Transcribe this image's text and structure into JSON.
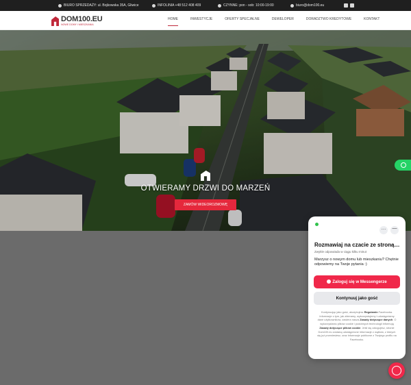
{
  "topbar": {
    "office": "BIURO SPRZEDAŻY: ul. Bojkowska 35A, Gliwice",
    "phone": "INFOLINIA +48 512 408 409",
    "hours": "CZYNNE: pon - sob: 10:00-19:00",
    "email": "biuro@dom100.eu",
    "social_icons": [
      "facebook-icon",
      "instagram-icon"
    ]
  },
  "header": {
    "logo_name": "DOM100.EU",
    "logo_tagline": "NOWE DOMY I MIESZKANIA",
    "nav": [
      {
        "label": "HOME",
        "active": true
      },
      {
        "label": "INWESTYCJE",
        "active": false
      },
      {
        "label": "OFERTY SPECJALNE",
        "active": false
      },
      {
        "label": "DEWELOPER",
        "active": false
      },
      {
        "label": "DORADZTWO KREDYTOWE",
        "active": false
      },
      {
        "label": "KONTAKT",
        "active": false
      }
    ]
  },
  "hero": {
    "title": "OTWIERAMY DRZWI DO MARZEŃ",
    "cta": "ZAMÓW WIDEOROZMOWĘ"
  },
  "chat": {
    "title": "Rozmawiaj na czacie ze stroną…",
    "subtitle": "Zwykle odpowiada w ciągu kilku minut",
    "message": "Marzysz o nowym domu lub mieszkaniu? Chętnie odpowiemy na Twoje pytania :)",
    "messenger_button": "Zaloguj się w Messengerze",
    "guest_button": "Kontynuuj jako gość",
    "legal_part1": "Kontynuując jako gość, akceptujesz ",
    "legal_link1": "Regulamin",
    "legal_part2": " Facebooka. Informacje o tym, jak zbieramy, wykorzystujemy i udostępniamy dane użytkowników, zawiera nasza ",
    "legal_link2": "Zasady dotyczące danych",
    "legal_part3": ". O wykorzystaniu plików cookie i podobnych technologii informują ",
    "legal_link3": "Zasady dotyczące plików cookie",
    "legal_part4": ". Jeśli się zalogujesz, stronie Dom100.eu zostaną udostępnione informacje z wątków, z których się już przeniesiesz, oraz informacje publiczne z Twojego profilu na Facebooku.",
    "more_label": "…",
    "min_label": "—"
  },
  "colors": {
    "brand_red": "#c0283a",
    "cta_red": "#e5283c",
    "messenger_red": "#f0284a",
    "whatsapp_green": "#25d366",
    "online_green": "#31c24d"
  }
}
